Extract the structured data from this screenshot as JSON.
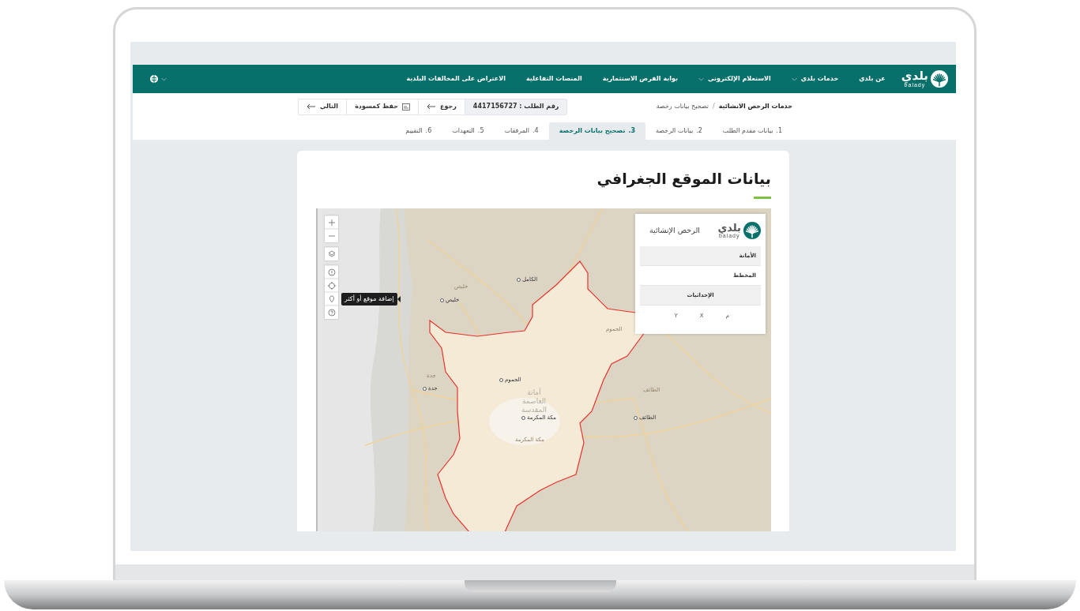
{
  "header": {
    "logo": {
      "arabic": "بلدي",
      "latin": "balady"
    },
    "nav": [
      {
        "label": "عن بلدي",
        "has_dropdown": false
      },
      {
        "label": "خدمات بلدي",
        "has_dropdown": true
      },
      {
        "label": "الاستعلام الإلكتروني",
        "has_dropdown": true
      },
      {
        "label": "بوابة الفرص الاستثمارية",
        "has_dropdown": false
      },
      {
        "label": "المنصات التفاعلية",
        "has_dropdown": false
      },
      {
        "label": "الاعتراض على المخالفات البلدية",
        "has_dropdown": false
      }
    ]
  },
  "breadcrumb": [
    {
      "label": "خدمات الرخص الانشائية",
      "current": false
    },
    {
      "label": "تصحيح بيانات رخصة",
      "current": true
    }
  ],
  "separator": "/",
  "request_number": "رقم الطلب : 4417156727",
  "actions": [
    {
      "kind": "back",
      "label": "رجوع"
    },
    {
      "kind": "draft",
      "label": "حفظ كمسودة"
    },
    {
      "kind": "next",
      "label": "التالي"
    }
  ],
  "steps": [
    {
      "number": "1.",
      "label": "بيانات مقدم الطلب",
      "selected": false
    },
    {
      "number": "2.",
      "label": "بيانات الرخصة",
      "selected": false
    },
    {
      "number": "3.",
      "label": "تصحيح بيانات الرخصة",
      "selected": true
    },
    {
      "number": "4.",
      "label": "المرفقات",
      "selected": false
    },
    {
      "number": "5.",
      "label": "التعهدات",
      "selected": false
    },
    {
      "number": "6.",
      "label": "التقييم",
      "selected": false
    }
  ],
  "section_title": "بيانات الموقع الجغرافي",
  "map": {
    "controls": [
      {
        "kind": "zoom_in"
      },
      {
        "kind": "zoom_out"
      },
      {
        "kind": "layers"
      },
      {
        "kind": "info"
      },
      {
        "kind": "locate"
      },
      {
        "kind": "add_location",
        "tooltip": "إضافة موقع أو أكثر"
      },
      {
        "kind": "help"
      }
    ],
    "labels": [
      {
        "text": "الكامل",
        "kind": "city"
      },
      {
        "text": "خليص",
        "kind": "faint"
      },
      {
        "text": "خليص",
        "kind": "city"
      },
      {
        "text": "الجموم",
        "kind": "faint"
      },
      {
        "text": "جدة",
        "kind": "faint"
      },
      {
        "text": "جدة",
        "kind": "city"
      },
      {
        "text": "الجموم",
        "kind": "city"
      },
      {
        "text": "أمانة العاصمة المقدسة",
        "kind": "region"
      },
      {
        "text": "مكة المكرمة",
        "kind": "city"
      },
      {
        "text": "الطائف",
        "kind": "faint"
      },
      {
        "text": "الطائف",
        "kind": "city"
      },
      {
        "text": "مكة المكرمة",
        "kind": "faint"
      }
    ],
    "panel": {
      "logo": {
        "arabic": "بلدي",
        "latin": "balady"
      },
      "title": "الرخص الإنشائية",
      "rows": [
        {
          "kind": "field",
          "label": "الأمانة",
          "shaded": true
        },
        {
          "kind": "field",
          "label": "المخطط",
          "shaded": false
        },
        {
          "kind": "section",
          "label": "الإحداثيات",
          "shaded": true
        }
      ],
      "columns": [
        "م",
        "X",
        "Y"
      ]
    }
  }
}
